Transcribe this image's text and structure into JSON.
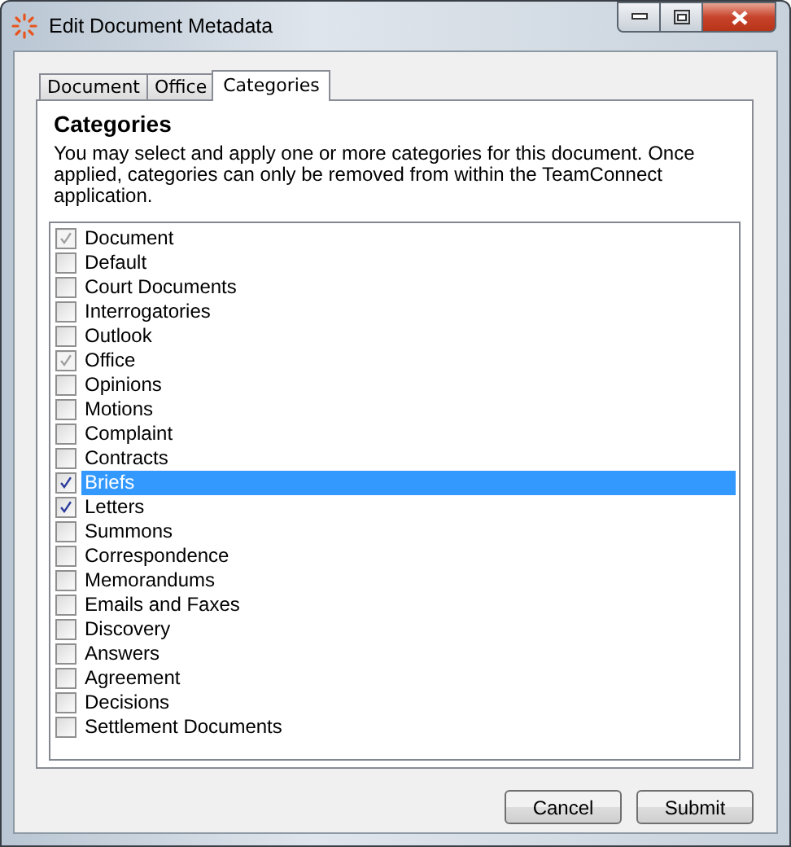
{
  "window": {
    "title": "Edit Document Metadata"
  },
  "tabs": [
    {
      "label": "Document",
      "selected": false
    },
    {
      "label": "Office",
      "selected": false
    },
    {
      "label": "Categories",
      "selected": true
    }
  ],
  "panel": {
    "heading": "Categories",
    "description": "You may select and apply one or more categories for this document. Once applied, categories can only be removed from within the TeamConnect application."
  },
  "categories": [
    {
      "label": "Document",
      "checked": true,
      "disabled": true,
      "selected": false
    },
    {
      "label": "Default",
      "checked": false,
      "disabled": false,
      "selected": false
    },
    {
      "label": "Court Documents",
      "checked": false,
      "disabled": false,
      "selected": false
    },
    {
      "label": "Interrogatories",
      "checked": false,
      "disabled": false,
      "selected": false
    },
    {
      "label": "Outlook",
      "checked": false,
      "disabled": false,
      "selected": false
    },
    {
      "label": "Office",
      "checked": true,
      "disabled": true,
      "selected": false
    },
    {
      "label": "Opinions",
      "checked": false,
      "disabled": false,
      "selected": false
    },
    {
      "label": "Motions",
      "checked": false,
      "disabled": false,
      "selected": false
    },
    {
      "label": "Complaint",
      "checked": false,
      "disabled": false,
      "selected": false
    },
    {
      "label": "Contracts",
      "checked": false,
      "disabled": false,
      "selected": false
    },
    {
      "label": "Briefs",
      "checked": true,
      "disabled": false,
      "selected": true
    },
    {
      "label": "Letters",
      "checked": true,
      "disabled": false,
      "selected": false
    },
    {
      "label": "Summons",
      "checked": false,
      "disabled": false,
      "selected": false
    },
    {
      "label": "Correspondence",
      "checked": false,
      "disabled": false,
      "selected": false
    },
    {
      "label": "Memorandums",
      "checked": false,
      "disabled": false,
      "selected": false
    },
    {
      "label": "Emails and Faxes",
      "checked": false,
      "disabled": false,
      "selected": false
    },
    {
      "label": "Discovery",
      "checked": false,
      "disabled": false,
      "selected": false
    },
    {
      "label": "Answers",
      "checked": false,
      "disabled": false,
      "selected": false
    },
    {
      "label": "Agreement",
      "checked": false,
      "disabled": false,
      "selected": false
    },
    {
      "label": "Decisions",
      "checked": false,
      "disabled": false,
      "selected": false
    },
    {
      "label": "Settlement Documents",
      "checked": false,
      "disabled": false,
      "selected": false
    }
  ],
  "buttons": [
    {
      "label": "Cancel"
    },
    {
      "label": "Submit"
    }
  ]
}
